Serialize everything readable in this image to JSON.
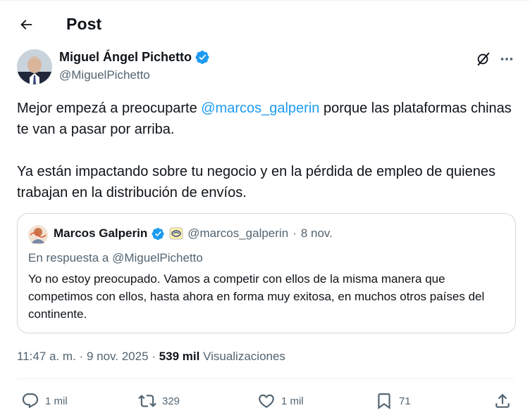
{
  "header": {
    "title": "Post",
    "back_icon": "arrow-left-icon"
  },
  "author": {
    "name": "Miguel Ángel Pichetto",
    "handle": "@MiguelPichetto",
    "verified_color": "#1d9bf0"
  },
  "post": {
    "paragraph1_before": "Mejor empezá a preocuparte ",
    "paragraph1_mention": "@marcos_galperin",
    "paragraph1_after": " porque las plataformas chinas te  van a pasar por arriba.",
    "paragraph2": "Ya están impactando sobre tu negocio y en la pérdida de empleo de quienes trabajan en la distribución de envíos."
  },
  "quote": {
    "name": "Marcos Galperin",
    "handle": "@marcos_galperin",
    "separator": "·",
    "date": "8 nov.",
    "reply_to": "En respuesta a @MiguelPichetto",
    "text": "Yo no estoy preocupado. Vamos a competir con ellos de la misma manera que competimos con ellos, hasta ahora en forma muy exitosa, en muchos otros países del continente."
  },
  "meta": {
    "time": "11:47 a. m.",
    "sep1": "·",
    "date": "9 nov. 2025",
    "sep2": "·",
    "views_count": "539 mil",
    "views_label": "Visualizaciones"
  },
  "actions": {
    "replies": "1 mil",
    "reposts": "329",
    "likes": "1 mil",
    "bookmarks": "71"
  },
  "colors": {
    "accent": "#1d9bf0",
    "text": "#0f1419",
    "secondary": "#536471",
    "border": "#cfd9de"
  }
}
